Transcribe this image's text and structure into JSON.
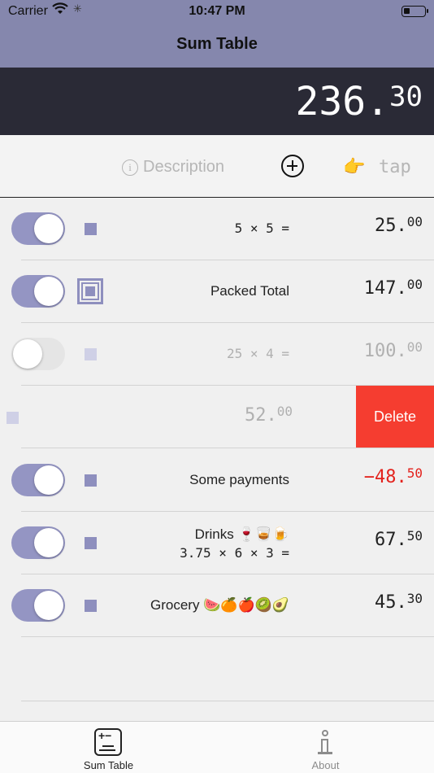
{
  "status_bar": {
    "carrier": "Carrier",
    "time": "10:47 PM",
    "battery_level": 0.25
  },
  "nav": {
    "title": "Sum Table"
  },
  "total": {
    "integer": "236.",
    "decimal": "30"
  },
  "input_bar": {
    "info_glyph": "i",
    "description_placeholder": "Description",
    "hand_icon": "👉",
    "tap_label": "tap"
  },
  "rows": [
    {
      "toggle": "on",
      "marker": "square",
      "label": "5 × 5 =",
      "amount_int": "25.",
      "amount_dec": "00"
    },
    {
      "toggle": "on",
      "marker": "packed",
      "label": "Packed Total",
      "amount_int": "147.",
      "amount_dec": "00"
    },
    {
      "toggle": "off",
      "marker": "square-dim",
      "label": "25 × 4 =",
      "amount_int": "100.",
      "amount_dec": "00"
    },
    {
      "swiped": true,
      "amount_int": "52.",
      "amount_dec": "00",
      "delete_label": "Delete"
    },
    {
      "toggle": "on",
      "marker": "square",
      "label": "Some payments",
      "amount_int": "−48.",
      "amount_dec": "50",
      "color": "#e3221c"
    },
    {
      "toggle": "on",
      "marker": "square",
      "label_line1": "Drinks 🍷🥃🍺",
      "label_line2": "3.75 × 6 × 3 =",
      "amount_int": "67.",
      "amount_dec": "50"
    },
    {
      "toggle": "on",
      "marker": "square",
      "label": "Grocery 🍉🍊🍎🥝🥑",
      "amount_int": "45.",
      "amount_dec": "30"
    }
  ],
  "tabs": [
    {
      "label": "Sum Table",
      "icon": "sum-table-icon",
      "active": true
    },
    {
      "label": "About",
      "icon": "info-icon",
      "active": false
    }
  ]
}
